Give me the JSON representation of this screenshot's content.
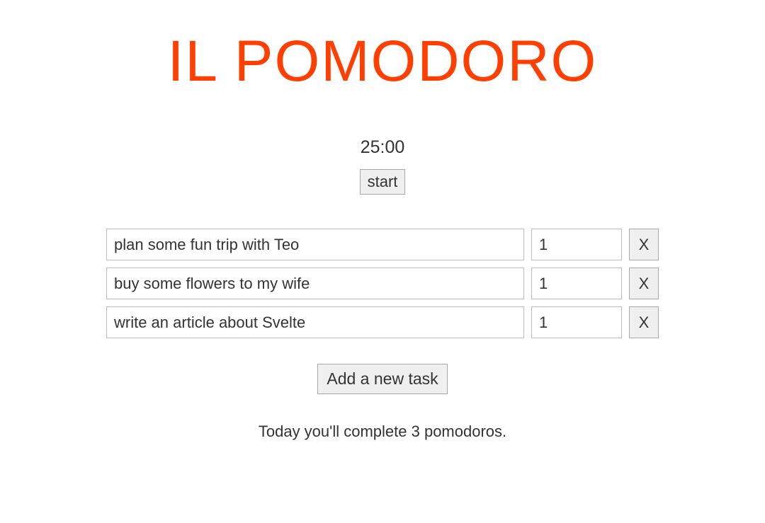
{
  "title": "IL POMODORO",
  "timer": "25:00",
  "start_label": "start",
  "tasks": [
    {
      "name": "plan some fun trip with Teo",
      "count": "1",
      "delete_label": "X"
    },
    {
      "name": "buy some flowers to my wife",
      "count": "1",
      "delete_label": "X"
    },
    {
      "name": "write an article about Svelte",
      "count": "1",
      "delete_label": "X"
    }
  ],
  "add_task_label": "Add a new task",
  "summary": "Today you'll complete 3 pomodoros."
}
